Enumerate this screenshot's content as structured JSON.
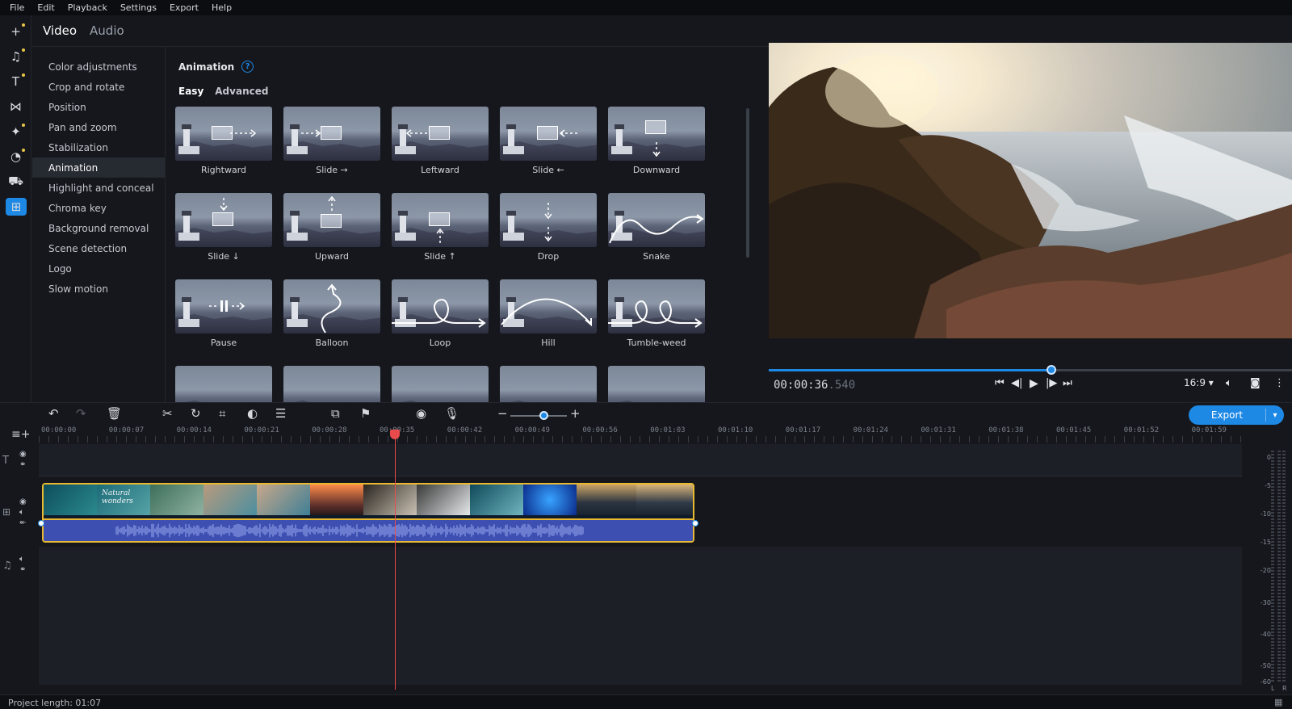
{
  "menu": [
    "File",
    "Edit",
    "Playback",
    "Settings",
    "Export",
    "Help"
  ],
  "tabs": {
    "video": "Video",
    "audio": "Audio"
  },
  "rail_icons": [
    "add-icon",
    "music-note-icon",
    "text-icon",
    "transitions-icon",
    "magic-wand-icon",
    "filters-icon",
    "stickers-icon",
    "more-tools-icon"
  ],
  "fx_list": [
    "Color adjustments",
    "Crop and rotate",
    "Position",
    "Pan and zoom",
    "Stabilization",
    "Animation",
    "Highlight and conceal",
    "Chroma key",
    "Background removal",
    "Scene detection",
    "Logo",
    "Slow motion"
  ],
  "animation": {
    "title": "Animation",
    "help": "?",
    "subtab_easy": "Easy",
    "subtab_advanced": "Advanced",
    "presets": [
      "Rightward",
      "Slide →",
      "Leftward",
      "Slide ←",
      "Downward",
      "Slide ↓",
      "Upward",
      "Slide ↑",
      "Drop",
      "Snake",
      "Pause",
      "Balloon",
      "Loop",
      "Hill",
      "Tumble-weed"
    ]
  },
  "player": {
    "timecode_main": "00:00:36",
    "timecode_ms": ".540",
    "progress": 0.54,
    "aspect": "16:9 ▾"
  },
  "export": {
    "label": "Export",
    "dropdown": "▾"
  },
  "ruler": [
    "00:00:00",
    "00:00:07",
    "00:00:14",
    "00:00:21",
    "00:00:28",
    "00:00:35",
    "00:00:42",
    "00:00:49",
    "00:00:56",
    "00:01:03",
    "00:01:10",
    "00:01:17",
    "00:01:24",
    "00:01:31",
    "00:01:38",
    "00:01:45",
    "00:01:52",
    "00:01:59"
  ],
  "clip_title": "Natural wonders",
  "meter": {
    "db_labels": [
      "0",
      "-5",
      "-10",
      "-15",
      "-20",
      "-30",
      "-40",
      "-50",
      "-60"
    ],
    "left": "L",
    "right": "R"
  },
  "status": "Project length: 01:07",
  "colors": {
    "accent": "#1e88e5",
    "clip_border": "#e8b931",
    "playhead": "#e84b4b"
  }
}
